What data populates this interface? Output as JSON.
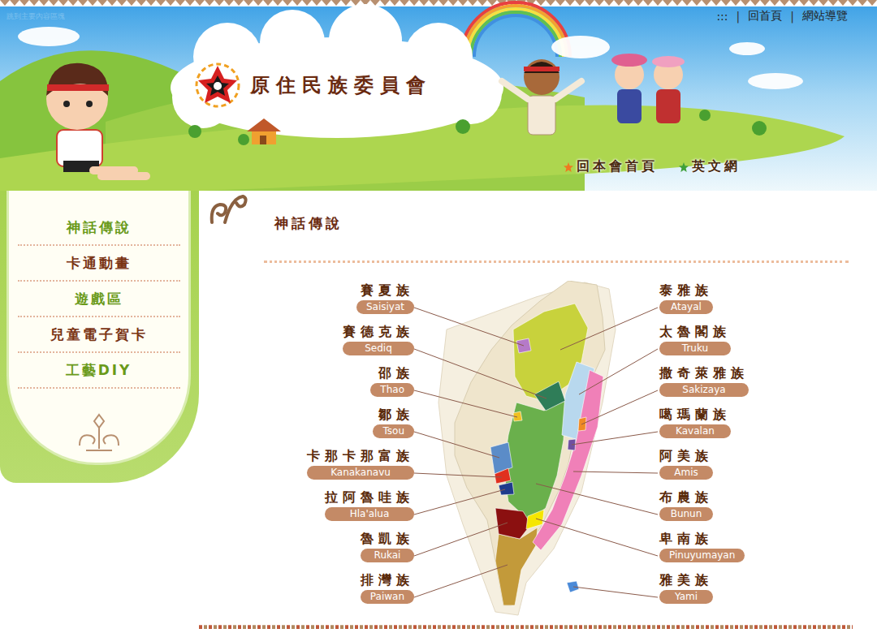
{
  "skip_link": "跳到主要內容區塊",
  "top_links": {
    "marker": ":::",
    "separator": "|",
    "items": [
      "回首頁",
      "網站導覽"
    ]
  },
  "site_title": "原住民族委員會",
  "nav": [
    {
      "label": "回本會首頁",
      "color": "#f07820"
    },
    {
      "label": "英文網",
      "color": "#3fa03a"
    }
  ],
  "sidebar": {
    "items": [
      "神話傳說",
      "卡通動畫",
      "遊戲區",
      "兒童電子賀卡",
      "工藝DIY"
    ]
  },
  "page_title": "神話傳說",
  "map": {
    "tribes_left": [
      {
        "name": "賽夏族",
        "romanized": "Saisiyat",
        "color": "#b57ac8"
      },
      {
        "name": "賽德克族",
        "romanized": "Sediq",
        "color": "#2f7d58"
      },
      {
        "name": "邵族",
        "romanized": "Thao",
        "color": "#f0c020"
      },
      {
        "name": "鄒族",
        "romanized": "Tsou",
        "color": "#5b8cc8"
      },
      {
        "name": "卡那卡那富族",
        "romanized": "Kanakanavu",
        "color": "#e0301e"
      },
      {
        "name": "拉阿魯哇族",
        "romanized": "Hla'alua",
        "color": "#1f3b8c"
      },
      {
        "name": "魯凱族",
        "romanized": "Rukai",
        "color": "#8b1010"
      },
      {
        "name": "排灣族",
        "romanized": "Paiwan",
        "color": "#c39a3a"
      }
    ],
    "tribes_right": [
      {
        "name": "泰雅族",
        "romanized": "Atayal",
        "color": "#c8d23c"
      },
      {
        "name": "太魯閣族",
        "romanized": "Truku",
        "color": "#b8d8ee"
      },
      {
        "name": "撒奇萊雅族",
        "romanized": "Sakizaya",
        "color": "#f08a24"
      },
      {
        "name": "噶瑪蘭族",
        "romanized": "Kavalan",
        "color": "#7050a0"
      },
      {
        "name": "阿美族",
        "romanized": "Amis",
        "color": "#f080b8"
      },
      {
        "name": "布農族",
        "romanized": "Bunun",
        "color": "#6ab04c"
      },
      {
        "name": "卑南族",
        "romanized": "Pinuyumayan",
        "color": "#f5e600"
      },
      {
        "name": "雅美族",
        "romanized": "Yami",
        "color": "#4a8ad8"
      }
    ]
  }
}
